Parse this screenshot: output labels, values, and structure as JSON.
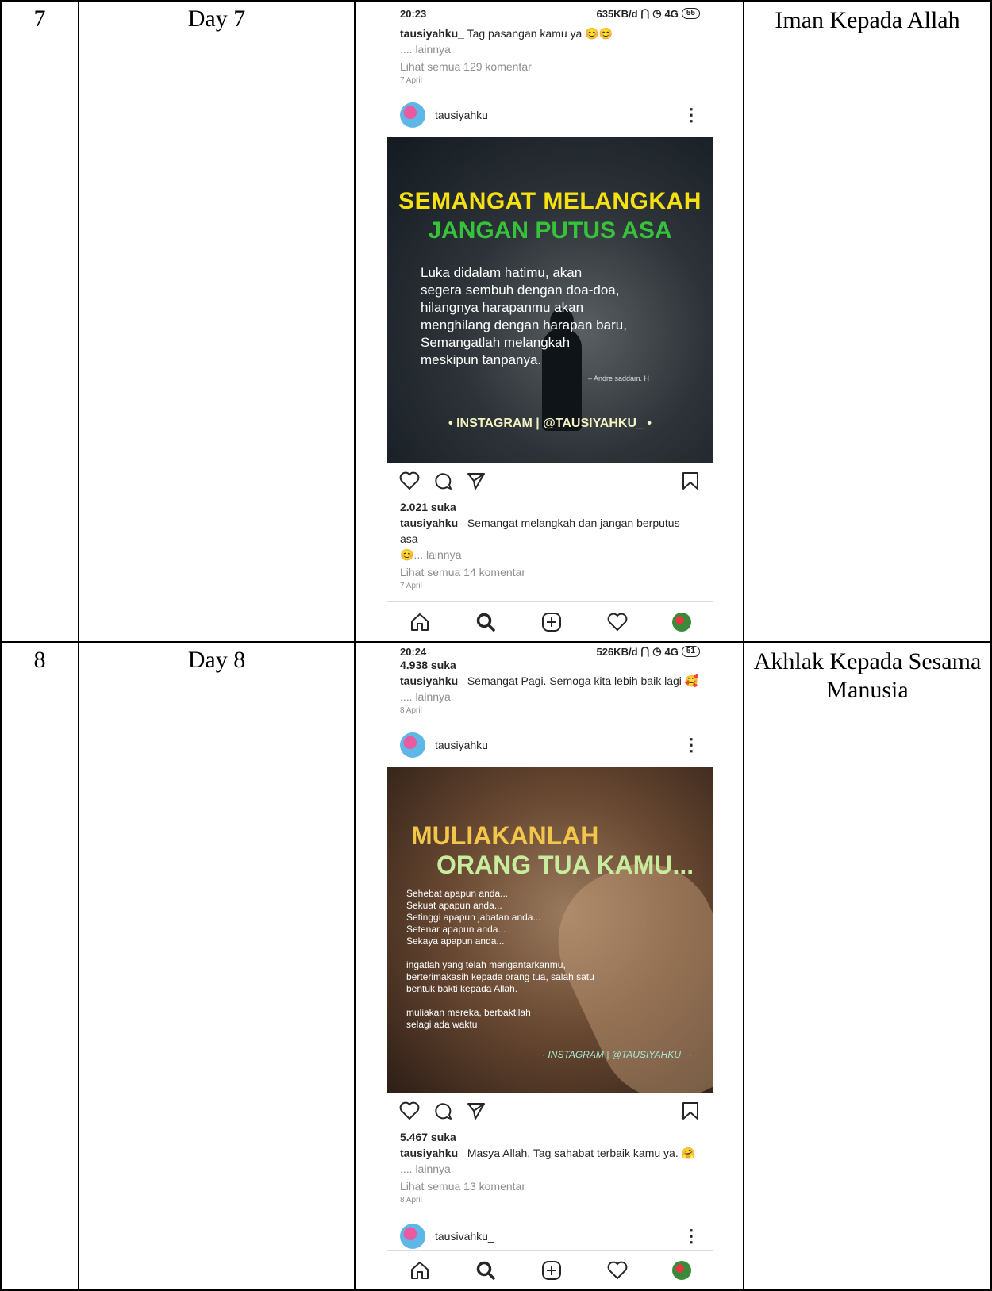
{
  "rows": [
    {
      "no": "7",
      "day": "Day 7",
      "topic": "Iman Kepada Allah",
      "phone": {
        "time": "20:23",
        "net": "635KB/d",
        "signal": "4G",
        "battery": "55",
        "prev_caption_user": "tausiyahku_",
        "prev_caption_text": "Tag pasangan kamu ya 😊😊",
        "prev_more": ".... lainnya",
        "prev_comments": "Lihat semua 129 komentar",
        "prev_date": "7 April",
        "post_user": "tausiyahku_",
        "img_title1": "SEMANGAT MELANGKAH",
        "img_title2": "JANGAN PUTUS ASA",
        "img_quote": "Luka didalam hatimu, akan\nsegera sembuh dengan doa-doa,\nhilangnya harapanmu akan\nmenghilang dengan harapan baru,\nSemangatlah melangkah\nmeskipun tanpanya.",
        "img_author": "– Andre saddam. H",
        "img_footer": "• INSTAGRAM | @TAUSIYAHKU_ •",
        "likes": "2.021 suka",
        "caption_user": "tausiyahku_",
        "caption_text": "Semangat melangkah dan jangan berputus asa",
        "caption_more": "😊... lainnya",
        "comments": "Lihat semua 14 komentar",
        "date": "7 April"
      }
    },
    {
      "no": "8",
      "day": "Day 8",
      "topic": "Akhlak Kepada Sesama Manusia",
      "phone": {
        "time": "20:24",
        "net": "526KB/d",
        "signal": "4G",
        "battery": "51",
        "prev_likes": "4.938 suka",
        "prev_caption_user": "tausiyahku_",
        "prev_caption_text": "Semangat Pagi. Semoga kita lebih baik lagi 🥰",
        "prev_more": ".... lainnya",
        "prev_date": "8 April",
        "post_user": "tausiyahku_",
        "img_title1": "MULIAKANLAH",
        "img_title2": "ORANG TUA KAMU...",
        "img_quote": "Sehebat apapun anda...\nSekuat apapun anda...\nSetinggi apapun jabatan anda...\nSetenar apapun anda...\nSekaya apapun anda...\n\ningatlah yang telah mengantarkanmu,\nberterimakasih kepada orang tua, salah satu\nbentuk bakti kepada Allah.\n\nmuliakan mereka, berbaktilah\nselagi ada waktu",
        "img_footer": "· INSTAGRAM | @TAUSIYAHKU_ ·",
        "likes": "5.467 suka",
        "caption_user": "tausiyahku_",
        "caption_text": "Masya Allah. Tag sahabat terbaik kamu ya. 🤗",
        "caption_more": ".... lainnya",
        "comments": "Lihat semua 13 komentar",
        "date": "8 April",
        "next_user": "tausivahku_"
      }
    }
  ],
  "icons": {
    "nav": [
      "home-icon",
      "search-icon",
      "add-icon",
      "heart-icon",
      "profile-avatar"
    ],
    "actions": [
      "like-icon",
      "comment-icon",
      "share-icon",
      "save-icon"
    ]
  }
}
